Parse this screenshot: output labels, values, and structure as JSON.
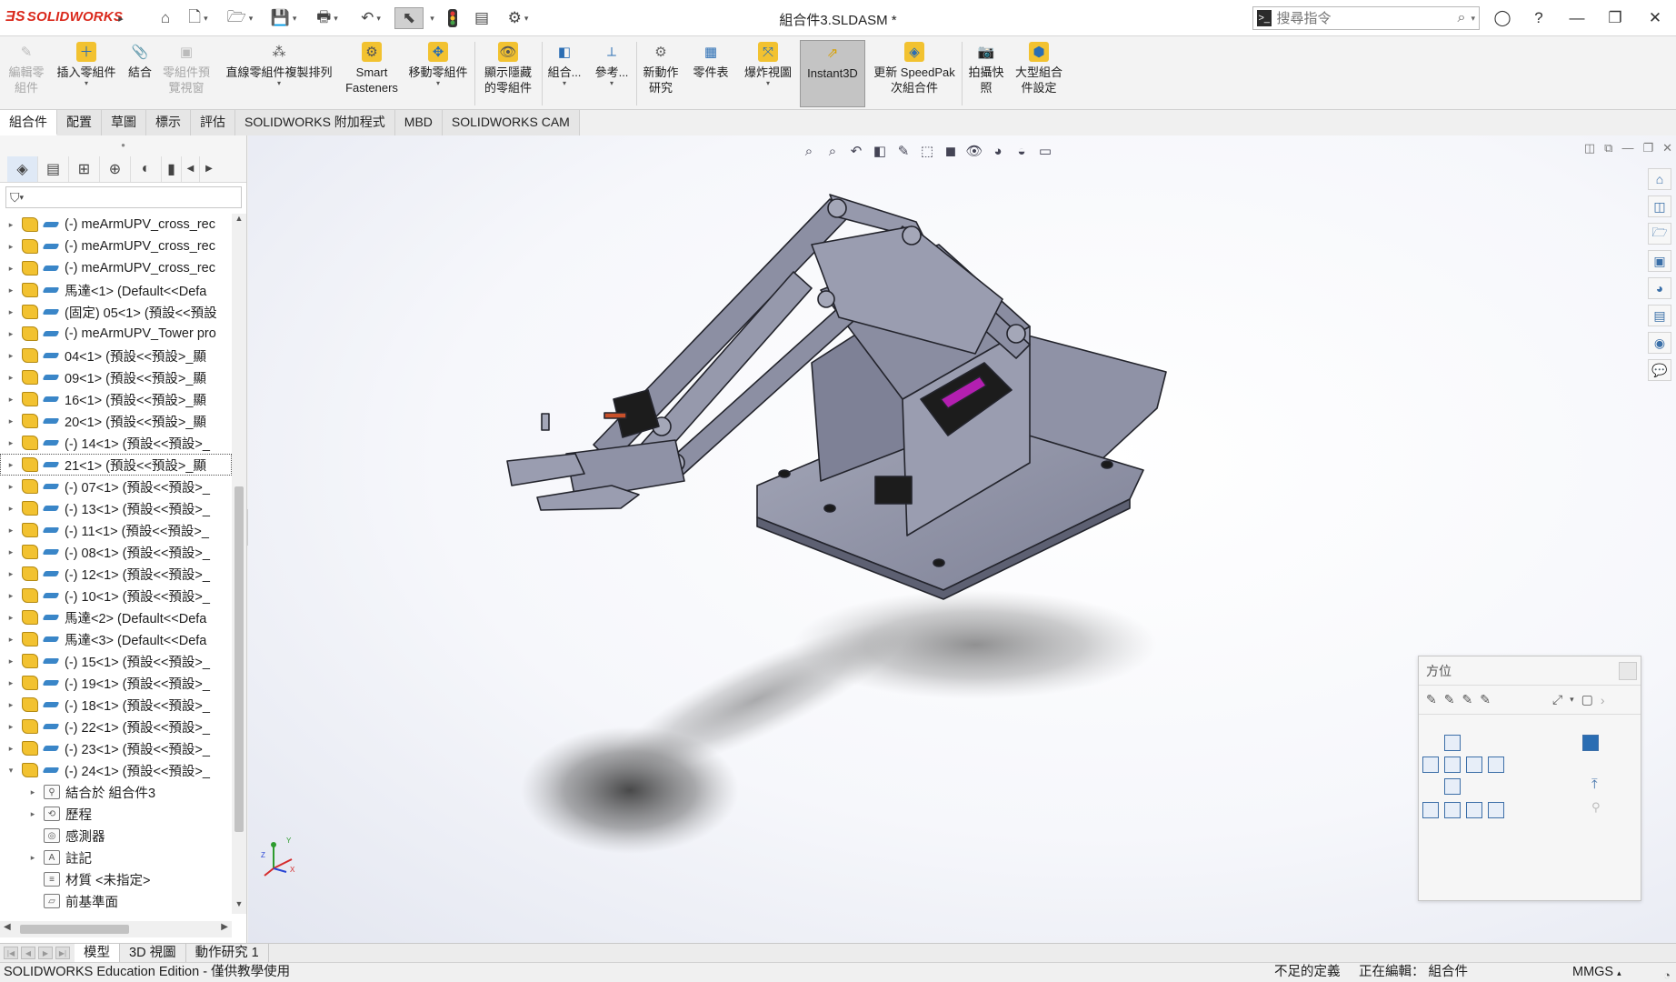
{
  "app": {
    "logo_text": "SOLIDWORKS",
    "document_title": "組合件3.SLDASM *"
  },
  "search": {
    "placeholder": "搜尋指令"
  },
  "ribbon": [
    {
      "label": "編輯零\n組件",
      "enabled": false
    },
    {
      "label": "插入零組件",
      "enabled": true
    },
    {
      "label": "結合",
      "enabled": true
    },
    {
      "label": "零組件預\n覽視窗",
      "enabled": false
    },
    {
      "label": "直線零組件複製排列",
      "enabled": true
    },
    {
      "label": "Smart\nFasteners",
      "enabled": true
    },
    {
      "label": "移動零組件",
      "enabled": true
    },
    {
      "label": "顯示隱藏\n的零組件",
      "enabled": true
    },
    {
      "label": "組合...",
      "enabled": true
    },
    {
      "label": "參考...",
      "enabled": true
    },
    {
      "label": "新動作\n研究",
      "enabled": true
    },
    {
      "label": "零件表",
      "enabled": true
    },
    {
      "label": "爆炸視圖",
      "enabled": true
    },
    {
      "label": "Instant3D",
      "enabled": true
    },
    {
      "label": "更新 SpeedPak\n次組合件",
      "enabled": true
    },
    {
      "label": "拍攝快\n照",
      "enabled": true
    },
    {
      "label": "大型組合\n件設定",
      "enabled": true
    }
  ],
  "command_tabs": [
    "組合件",
    "配置",
    "草圖",
    "標示",
    "評估",
    "SOLIDWORKS 附加程式",
    "MBD",
    "SOLIDWORKS CAM"
  ],
  "tree": {
    "components": [
      "(-) meArmUPV_cross_rec",
      "(-) meArmUPV_cross_rec",
      "(-) meArmUPV_cross_rec",
      "馬達<1> (Default<<Defa",
      "(固定) 05<1> (預設<<預設",
      "(-) meArmUPV_Tower pro",
      "04<1> (預設<<預設>_顯",
      "09<1> (預設<<預設>_顯",
      "16<1> (預設<<預設>_顯",
      "20<1> (預設<<預設>_顯",
      "(-) 14<1> (預設<<預設>_",
      "21<1> (預設<<預設>_顯",
      "(-) 07<1> (預設<<預設>_",
      "(-) 13<1> (預設<<預設>_",
      "(-) 11<1> (預設<<預設>_",
      "(-) 08<1> (預設<<預設>_",
      "(-) 12<1> (預設<<預設>_",
      "(-) 10<1> (預設<<預設>_",
      "馬達<2> (Default<<Defa",
      "馬達<3> (Default<<Defa",
      "(-) 15<1> (預設<<預設>_",
      "(-) 19<1> (預設<<預設>_",
      "(-) 18<1> (預設<<預設>_",
      "(-) 22<1> (預設<<預設>_",
      "(-) 23<1> (預設<<預設>_",
      "(-) 24<1> (預設<<預設>_"
    ],
    "selected_index": 11,
    "extras": [
      {
        "label": "結合於 組合件3",
        "icon": "mates-icon",
        "glyph": "⚲"
      },
      {
        "label": "歷程",
        "icon": "history-icon",
        "glyph": "⟲"
      },
      {
        "label": "感測器",
        "icon": "sensor-icon",
        "glyph": "◎"
      },
      {
        "label": "註記",
        "icon": "annotations-icon",
        "glyph": "A"
      },
      {
        "label": "材質 <未指定>",
        "icon": "material-icon",
        "glyph": "≡"
      },
      {
        "label": "前基準面",
        "icon": "plane-icon",
        "glyph": "▱"
      }
    ]
  },
  "orientation_dialog": {
    "title": "方位"
  },
  "bottom_tabs": [
    "模型",
    "3D 視圖",
    "動作研究 1"
  ],
  "status": {
    "edition": "SOLIDWORKS Education Edition - 僅供教學使用",
    "definition": "不足的定義",
    "editing": "正在編輯： 組合件",
    "units": "MMGS"
  },
  "colors": {
    "brand": "#da291c",
    "model_face": "#8c8fa3",
    "model_edge": "#2a2b33"
  }
}
